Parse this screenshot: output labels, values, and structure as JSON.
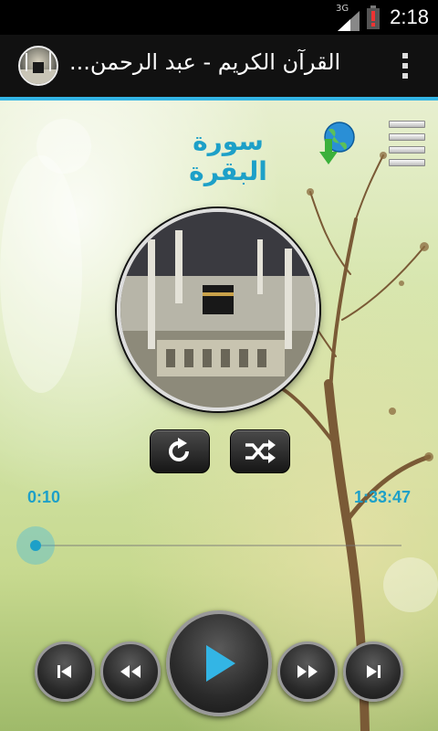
{
  "status_bar": {
    "network": "3G",
    "time": "2:18"
  },
  "action_bar": {
    "title": "القرآن الكريم - عبد الرحمن...",
    "app_icon": "kaaba-icon",
    "overflow_icon": "overflow-menu-icon"
  },
  "player": {
    "surah_title": "سورة البقرة",
    "download_icon": "globe-download-icon",
    "playlist_icon": "playlist-icon",
    "cover_icon": "kaaba-cover-image",
    "repeat_icon": "repeat-icon",
    "shuffle_icon": "shuffle-icon",
    "current_time": "0:10",
    "total_time": "1:33:47",
    "progress_fraction": 0.0018
  },
  "transport": {
    "prev_icon": "skip-previous-icon",
    "rewind_icon": "rewind-icon",
    "play_icon": "play-icon",
    "forward_icon": "fast-forward-icon",
    "next_icon": "skip-next-icon"
  },
  "colors": {
    "accent": "#33b5e5",
    "text_accent": "#1da0c8"
  }
}
